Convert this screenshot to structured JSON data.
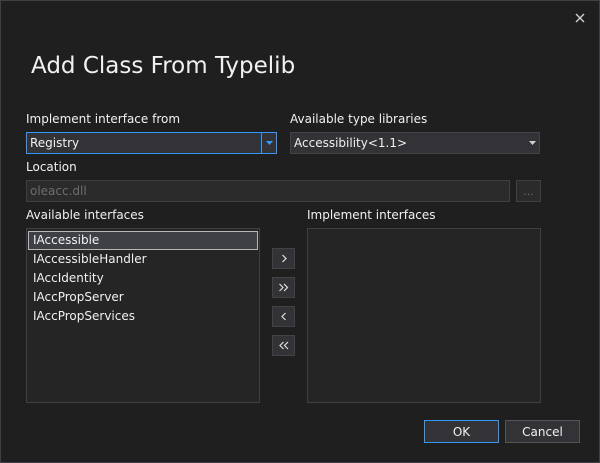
{
  "dialog": {
    "title": "Add Class From Typelib",
    "close_icon": "close-icon"
  },
  "implement_from": {
    "label": "Implement interface from",
    "value": "Registry"
  },
  "type_libraries": {
    "label": "Available type libraries",
    "value": "Accessibility<1.1>"
  },
  "location": {
    "label": "Location",
    "value": "oleacc.dll",
    "browse_label": "..."
  },
  "available_interfaces": {
    "label": "Available interfaces",
    "items": [
      "IAccessible",
      "IAccessibleHandler",
      "IAccIdentity",
      "IAccPropServer",
      "IAccPropServices"
    ],
    "selected_index": 0
  },
  "implement_interfaces": {
    "label": "Implement interfaces",
    "items": []
  },
  "move_buttons": {
    "add_one": "chevron-right-icon",
    "add_all": "double-chevron-right-icon",
    "remove_one": "chevron-left-icon",
    "remove_all": "double-chevron-left-icon"
  },
  "buttons": {
    "ok": "OK",
    "cancel": "Cancel"
  },
  "colors": {
    "background": "#1f1f1f",
    "focus_accent": "#3399ff",
    "text": "#f1f1f1",
    "disabled_text": "#6d6d6d"
  }
}
